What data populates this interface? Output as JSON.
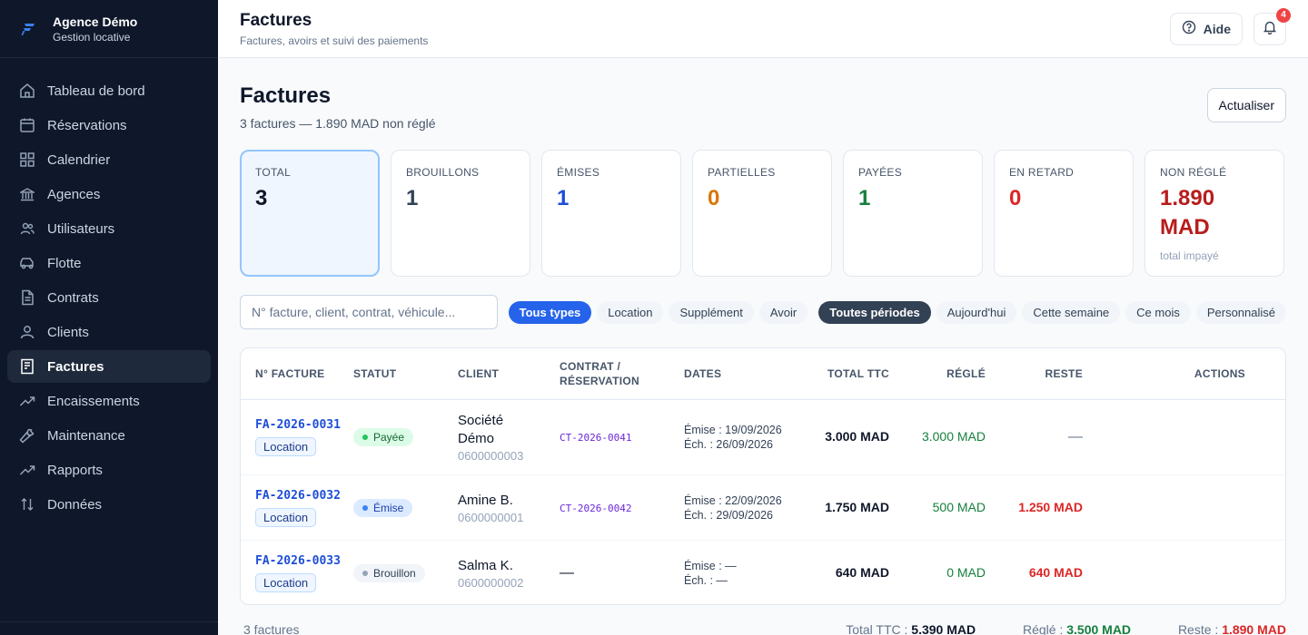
{
  "brand": {
    "name": "Agence Démo",
    "subtitle": "Gestion locative"
  },
  "sidebar": {
    "items": [
      {
        "label": "Tableau de bord",
        "icon": "home-icon"
      },
      {
        "label": "Réservations",
        "icon": "calendar-icon"
      },
      {
        "label": "Calendrier",
        "icon": "grid-icon"
      },
      {
        "label": "Agences",
        "icon": "bank-icon"
      },
      {
        "label": "Utilisateurs",
        "icon": "users-icon"
      },
      {
        "label": "Flotte",
        "icon": "car-icon"
      },
      {
        "label": "Contrats",
        "icon": "document-icon"
      },
      {
        "label": "Clients",
        "icon": "user-icon"
      },
      {
        "label": "Factures",
        "icon": "receipt-icon",
        "active": true
      },
      {
        "label": "Encaissements",
        "icon": "trend-icon"
      },
      {
        "label": "Maintenance",
        "icon": "wrench-icon"
      },
      {
        "label": "Rapports",
        "icon": "chart-line-icon"
      },
      {
        "label": "Données",
        "icon": "sort-icon"
      }
    ]
  },
  "header": {
    "title": "Factures",
    "subtitle": "Factures, avoirs et suivi des paiements",
    "help_label": "Aide",
    "notif_count": "4"
  },
  "page": {
    "title": "Factures",
    "summary": "3 factures — 1.890 MAD non réglé",
    "refresh_label": "Actualiser"
  },
  "stats": [
    {
      "label": "TOTAL",
      "value": "3",
      "color": "#0f172a"
    },
    {
      "label": "BROUILLONS",
      "value": "1",
      "color": "#334155"
    },
    {
      "label": "ÉMISES",
      "value": "1",
      "color": "#1d4ed8"
    },
    {
      "label": "PARTIELLES",
      "value": "0",
      "color": "#d97706"
    },
    {
      "label": "PAYÉES",
      "value": "1",
      "color": "#15803d"
    },
    {
      "label": "EN RETARD",
      "value": "0",
      "color": "#dc2626"
    },
    {
      "label": "NON RÉGLÉ",
      "value": "1.890 MAD",
      "note": "total impayé",
      "color": "#b91c1c"
    }
  ],
  "filters": {
    "search_placeholder": "N° facture, client, contrat, véhicule...",
    "types": [
      "Tous types",
      "Location",
      "Supplément",
      "Avoir"
    ],
    "periods": [
      "Toutes périodes",
      "Aujourd'hui",
      "Cette semaine",
      "Ce mois",
      "Personnalisé"
    ]
  },
  "table": {
    "headers": [
      "N° FACTURE",
      "STATUT",
      "CLIENT",
      "CONTRAT / RÉSERVATION",
      "DATES",
      "TOTAL TTC",
      "RÉGLÉ",
      "RESTE",
      "ACTIONS"
    ],
    "rows": [
      {
        "num": "FA-2026-0031",
        "type": "Location",
        "status": "Payée",
        "client": "Société Démo",
        "phone": "0600000003",
        "contract": "CT-2026-0041",
        "emise": "Émise : 19/09/2026",
        "ech": "Éch. : 26/09/2026",
        "total": "3.000 MAD",
        "regle": "3.000 MAD",
        "reste": "—"
      },
      {
        "num": "FA-2026-0032",
        "type": "Location",
        "status": "Émise",
        "client": "Amine B.",
        "phone": "0600000001",
        "contract": "CT-2026-0042",
        "emise": "Émise : 22/09/2026",
        "ech": "Éch. : 29/09/2026",
        "total": "1.750 MAD",
        "regle": "500 MAD",
        "reste": "1.250 MAD"
      },
      {
        "num": "FA-2026-0033",
        "type": "Location",
        "status": "Brouillon",
        "client": "Salma K.",
        "phone": "0600000002",
        "contract": "—",
        "emise": "Émise : —",
        "ech": "Éch. : —",
        "total": "640 MAD",
        "regle": "0 MAD",
        "reste": "640 MAD"
      }
    ]
  },
  "footer": {
    "count": "3 factures",
    "total_label": "Total TTC :",
    "total_value": "5.390 MAD",
    "regle_label": "Réglé :",
    "regle_value": "3.500 MAD",
    "reste_label": "Reste :",
    "reste_value": "1.890 MAD"
  }
}
